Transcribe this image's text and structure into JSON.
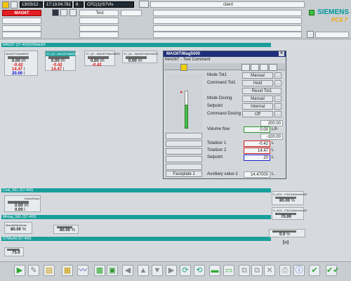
{
  "header": {
    "date": "13/03/12",
    "time": "17:13:04.761",
    "num": "8",
    "path": "CFC(1)/S7VIv",
    "area_button": "MAG6T",
    "test_label": "Test",
    "user": "client",
    "brand": "SIEMENS",
    "product": "PCS 7"
  },
  "sections": {
    "top": "MAG6T (37-400)/(KMaint)4",
    "coal": "Coal_SEL (S7-400)",
    "mixing": "Mixing_SEL (S7-400)",
    "station": "STMixAll (S7-400)"
  },
  "blocks": [
    {
      "title": "MAG6T/1MaI5000",
      "v1": "0.00",
      "u1": "l/h",
      "v2": "-0.42",
      "v3": "14.47",
      "u3": "l",
      "v4": "20.00",
      "u4": "l"
    },
    {
      "title": "S7_Q1...MAG6T/Mai5000",
      "v1": "0.00",
      "u1": "l/h",
      "v2": "-0.42",
      "v3": "14.47",
      "u3": "l"
    },
    {
      "title": "S7_Q1...MAG6T/MAG6000",
      "v1": "0.00",
      "u1": "l/h",
      "v2": "-0.42",
      "v3": "14.47",
      "u3": "l"
    },
    {
      "title": "S7_Q1...MAG6T/MAG6000",
      "v1": "0.00",
      "u1": "l/h"
    }
  ],
  "faceplate": {
    "title": "MAG6T/Mag5000",
    "subtitle": "MAG6T - Test Comment",
    "rows": [
      {
        "label": "Mode Tot1",
        "value": "Manual"
      },
      {
        "label": "Command Tot1",
        "value": "Hold"
      },
      {
        "label": "",
        "value": "Reset Tot1"
      },
      {
        "label": "Mode Dosing",
        "value": "Manual"
      },
      {
        "label": "Setpoint",
        "value": "Internal"
      },
      {
        "label": "Command Dosing",
        "value": "Off"
      }
    ],
    "scale_top": "200.00",
    "volume_label": "Volume flow",
    "volume_value": "0.00",
    "volume_unit": "L/h",
    "scale_bottom": "-100.00",
    "tot1_label": "Totalizer 1",
    "tot1_value": "-0.42",
    "tot1_unit": "L",
    "tot2_label": "Totalizer 2",
    "tot2_value": "14.47",
    "tot2_unit": "L",
    "sp_label": "Setpoint",
    "sp_value": "20",
    "sp_unit": "L",
    "aux_label": "Auxiliary value 2",
    "aux_value": "14.47000",
    "aux_unit": "L",
    "tab": "Faceplate 1"
  },
  "coal_block": {
    "title": "Dosis/Dosis",
    "v1": "0.00",
    "u1": "l/h",
    "v2": "0.00",
    "u2": "l"
  },
  "mixing_blocks": [
    {
      "title": "MainMi/MixMotor",
      "v": "80.00",
      "u": "%"
    },
    {
      "v": "80.00",
      "u": "%"
    }
  ],
  "station_block": {
    "v": "75.0"
  },
  "right_blocks": [
    {
      "title": "S_AO1...F/AO1Motor/Ax03",
      "v": "80.00",
      "u": "%"
    },
    {
      "title": "S_AO1...F/AO1Motor/Ax03",
      "v": "70.00"
    },
    {
      "v": "0.0",
      "u": "%"
    }
  ]
}
